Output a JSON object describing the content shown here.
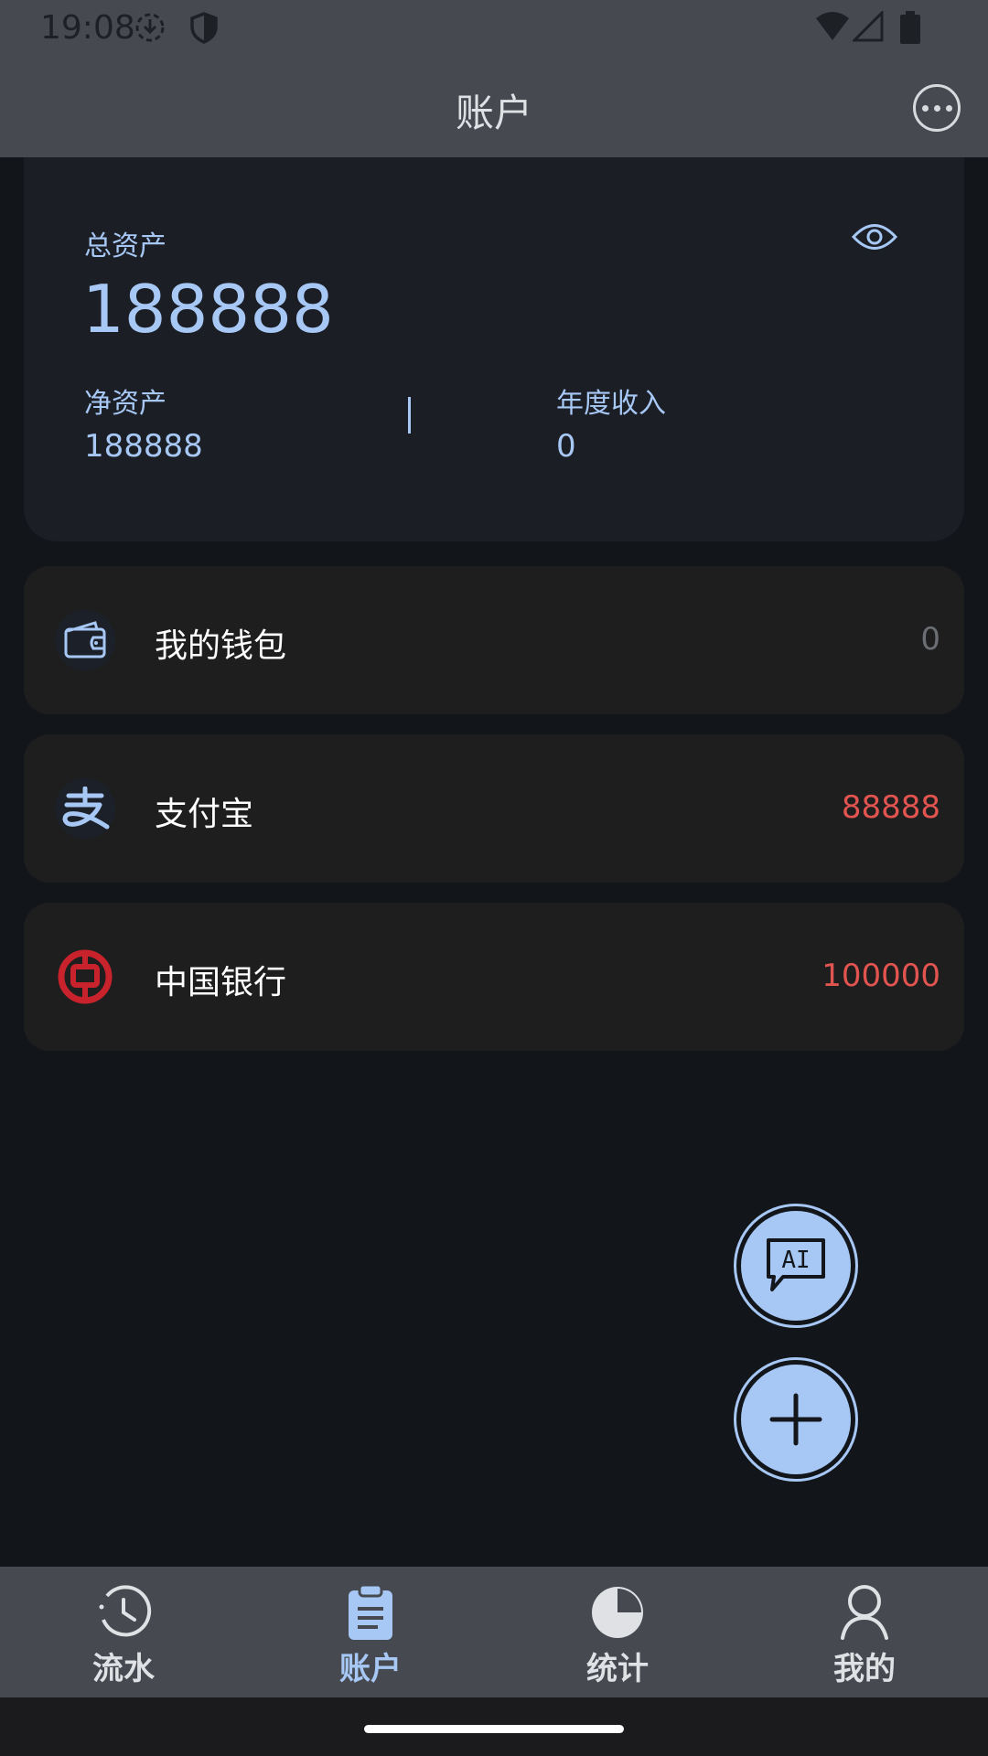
{
  "status_bar": {
    "time": "19:08",
    "icons": [
      "download-icon",
      "shield-icon",
      "wifi-icon",
      "signal-icon",
      "battery-icon"
    ]
  },
  "app_bar": {
    "title": "账户",
    "more_icon": "more-horizontal-icon"
  },
  "summary": {
    "total_label": "总资产",
    "total_value": "188888",
    "net_label": "净资产",
    "net_value": "188888",
    "income_label": "年度收入",
    "income_value": "0",
    "visibility_icon": "eye-icon"
  },
  "accounts": [
    {
      "name": "我的钱包",
      "amount": "0",
      "icon": "wallet-icon",
      "amount_color": "#6b6e73"
    },
    {
      "name": "支付宝",
      "amount": "88888",
      "icon": "alipay-icon",
      "amount_color": "#e2544f"
    },
    {
      "name": "中国银行",
      "amount": "100000",
      "icon": "bank-of-china-icon",
      "amount_color": "#e2544f"
    }
  ],
  "fabs": {
    "ai_label": "AI",
    "ai_icon": "ai-chat-icon",
    "add_icon": "plus-icon"
  },
  "bottom_nav": [
    {
      "label": "流水",
      "icon": "clock-history-icon",
      "active": false
    },
    {
      "label": "账户",
      "icon": "clipboard-icon",
      "active": true
    },
    {
      "label": "统计",
      "icon": "pie-chart-icon",
      "active": false
    },
    {
      "label": "我的",
      "icon": "person-icon",
      "active": false
    }
  ],
  "colors": {
    "accent": "#a7c8f5",
    "negative": "#e2544f",
    "bar": "#464a50",
    "background": "#12151a"
  }
}
